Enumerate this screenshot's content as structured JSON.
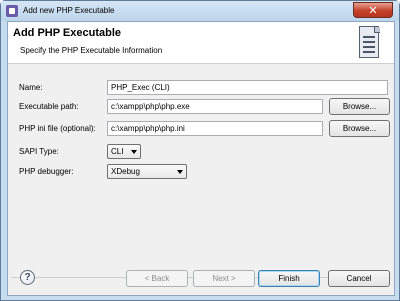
{
  "window": {
    "title": "Add new PHP Executable",
    "close_glyph": "✕"
  },
  "header": {
    "title": "Add PHP Executable",
    "subtitle": "Specify the PHP Executable Information"
  },
  "form": {
    "name": {
      "label": "Name:",
      "value": "PHP_Exec (CLI)"
    },
    "executable_path": {
      "label": "Executable path:",
      "value": "c:\\xampp\\php\\php.exe",
      "browse_label": "Browse..."
    },
    "php_ini": {
      "label": "PHP ini file (optional):",
      "value": "c:\\xampp\\php\\php.ini",
      "browse_label": "Browse..."
    },
    "sapi_type": {
      "label": "SAPI Type:",
      "value": "CLI"
    },
    "php_debugger": {
      "label": "PHP debugger:",
      "value": "XDebug"
    }
  },
  "footer": {
    "help_glyph": "?",
    "back_label": "< Back",
    "next_label": "Next >",
    "finish_label": "Finish",
    "cancel_label": "Cancel"
  },
  "icons": {
    "title_icon": "eclipse-app-icon",
    "wizard_icon": "wizard-document-icon",
    "help_icon": "help-icon"
  }
}
